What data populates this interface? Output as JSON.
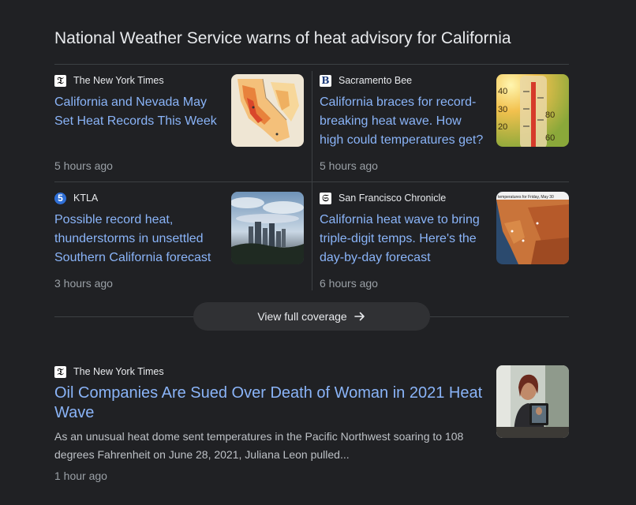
{
  "story_title": "National Weather Service warns of heat advisory for California",
  "cards": [
    {
      "source": "The New York Times",
      "source_icon": "nyt-logo-icon",
      "headline": "California and Nevada May Set Heat Records This Week",
      "time": "5 hours ago",
      "thumbnail": "heat-map-thumbnail"
    },
    {
      "source": "Sacramento Bee",
      "source_icon": "sacramento-bee-logo-icon",
      "headline": "California braces for record-breaking heat wave. How high could temperatures get?",
      "time": "5 hours ago",
      "thumbnail": "thermometer-thumbnail"
    },
    {
      "source": "KTLA",
      "source_icon": "ktla-logo-icon",
      "headline": "Possible record heat, thunderstorms in unsettled Southern California forecast",
      "time": "3 hours ago",
      "thumbnail": "los-angeles-skyline-thumbnail"
    },
    {
      "source": "San Francisco Chronicle",
      "source_icon": "sf-chronicle-logo-icon",
      "headline": "California heat wave to bring triple-digit temps. Here's the day-by-day forecast",
      "time": "6 hours ago",
      "thumbnail": "forecast-map-thumbnail"
    }
  ],
  "coverage_button": {
    "label": "View full coverage",
    "icon": "arrow-right-icon"
  },
  "featured": {
    "source": "The New York Times",
    "source_icon": "nyt-logo-icon",
    "headline": "Oil Companies Are Sued Over Death of Woman in 2021 Heat Wave",
    "snippet": "As an unusual heat dome sent temperatures in the Pacific Northwest soaring to 108 degrees Fahrenheit on June 28, 2021, Juliana Leon pulled...",
    "time": "1 hour ago",
    "thumbnail": "woman-holding-photo-thumbnail"
  },
  "thumb_text": {
    "map_title": "temperatures for Friday, May 30",
    "therm_scale": [
      "40",
      "30",
      "20",
      "80",
      "60"
    ]
  },
  "colors": {
    "background": "#202124",
    "link": "#8ab4f8",
    "secondary_text": "#9aa0a6",
    "divider": "#3c4043",
    "button_bg": "#303134"
  }
}
